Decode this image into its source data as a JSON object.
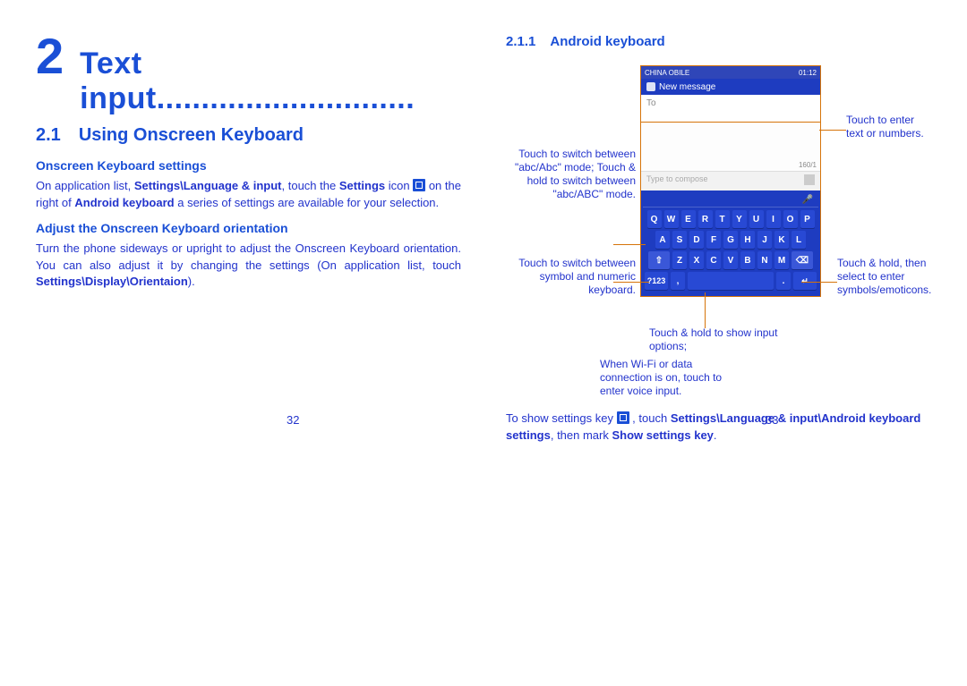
{
  "left": {
    "chapter_num": "2",
    "chapter_title": "Text input.............................",
    "section_num": "2.1",
    "section_title": "Using Onscreen Keyboard",
    "sub1": "Onscreen Keyboard settings",
    "para1_a": "On application list, ",
    "para1_b": "Settings\\Language & input",
    "para1_c": ", touch the ",
    "para1_d": "Settings",
    "para1_e": " icon ",
    "para1_f": " on the right of ",
    "para1_g": "Android keyboard",
    "para1_h": " a series of settings are available for your selection.",
    "sub2": "Adjust the Onscreen Keyboard orientation",
    "para2_a": "Turn the phone sideways or upright to adjust the Onscreen Keyboard orientation. You can also adjust it by changing the settings (On application list, touch ",
    "para2_b": "Settings\\Display\\Orientaion",
    "para2_c": ").",
    "page_num": "32"
  },
  "right": {
    "subsection_num": "2.1.1",
    "subsection_title": "Android keyboard",
    "status_left": "CHINA OBILE",
    "status_right": "01:12",
    "appbar_label": "New message",
    "to_label": "To",
    "char_count": "160/1",
    "compose_placeholder": "Type to compose",
    "row1": [
      "Q",
      "W",
      "E",
      "R",
      "T",
      "Y",
      "U",
      "I",
      "O",
      "P"
    ],
    "row2": [
      "A",
      "S",
      "D",
      "F",
      "G",
      "H",
      "J",
      "K",
      "L"
    ],
    "row3": [
      "Z",
      "X",
      "C",
      "V",
      "B",
      "N",
      "M"
    ],
    "key_shift": "⇧",
    "key_del": "⌫",
    "key_sym": "?123",
    "key_comma": ",",
    "key_period": ".",
    "key_enter": "↵",
    "callout_textarea": "Touch to enter text or numbers.",
    "callout_shift": "Touch to switch between \"abc/Abc\" mode; Touch & hold to switch between \"abc/ABC\" mode.",
    "callout_sym": "Touch to switch between symbol and numeric keyboard.",
    "callout_symhold": "Touch & hold, then select to enter symbols/emoticons.",
    "callout_options": "Touch & hold to show input options;",
    "callout_voice": "When Wi-Fi or data connection is on, touch to enter voice input.",
    "footnote_a": "To show settings key ",
    "footnote_b": " , touch ",
    "footnote_c": "Settings\\Language & input\\Android keyboard settings",
    "footnote_d": ", then mark ",
    "footnote_e": "Show settings key",
    "footnote_f": ".",
    "page_num": "33"
  }
}
